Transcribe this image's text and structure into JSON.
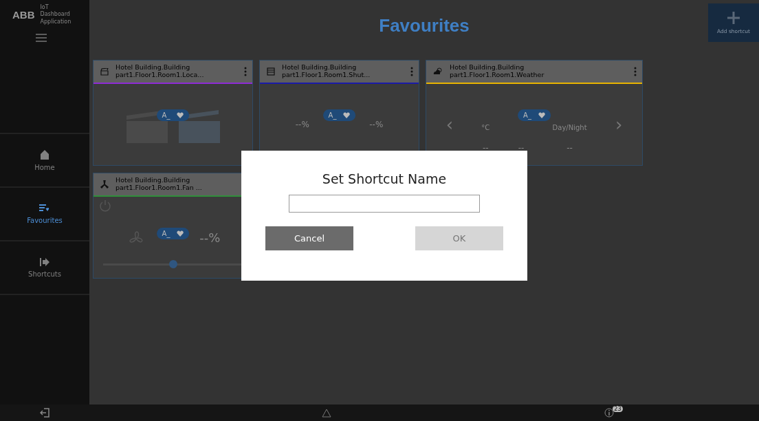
{
  "app": {
    "brand": "ABB",
    "name": "IoT Dashboard Application"
  },
  "nav": [
    {
      "label": "Home",
      "selected": false
    },
    {
      "label": "Favourites",
      "selected": true
    },
    {
      "label": "Shortcuts",
      "selected": false
    }
  ],
  "page_title": "Favourites",
  "add_shortcut": {
    "label": "Add shortcut"
  },
  "cards": [
    {
      "kind": "scene",
      "title": "Hotel Building.Building part1.Floor1.Room1.Loca...",
      "color": "#8e2bd6",
      "pill": "A_"
    },
    {
      "kind": "shutter",
      "title": "Hotel Building.Building part1.Floor1.Room1.Shut...",
      "color": "#1a1aa8",
      "pill": "A_",
      "readings": [
        "--%",
        "--%"
      ]
    },
    {
      "kind": "weather",
      "title": "Hotel Building.Building part1.Floor1.Room1.Weather",
      "color": "#e8b400",
      "pill": "A_",
      "prev": "‹",
      "next": "›",
      "unit": "°C",
      "mode": "Day/Night",
      "readings": [
        "--",
        "--",
        "--"
      ]
    },
    {
      "kind": "fan",
      "title": "Hotel Building.Building part1.Floor1.Room1.Fan ...",
      "color": "#2f8f3a",
      "pill": "A_",
      "readings": [
        "--%"
      ],
      "level": 0.5
    }
  ],
  "status_bar": {
    "notifications": "23"
  },
  "dialog": {
    "title": "Set Shortcut Name",
    "buttons": [
      {
        "label": "Cancel",
        "disabled": false
      },
      {
        "label": "OK",
        "disabled": true
      }
    ]
  }
}
